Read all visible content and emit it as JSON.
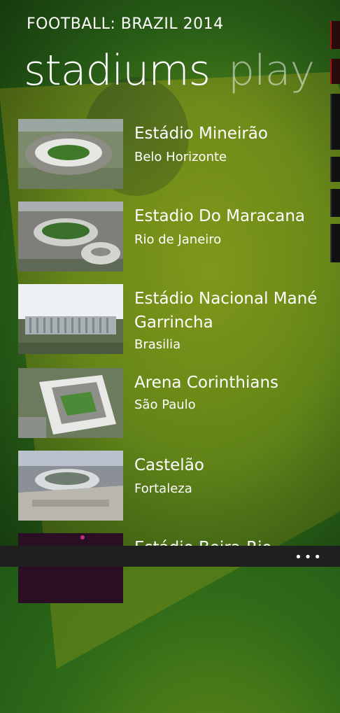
{
  "app_title": "FOOTBALL: BRAZIL 2014",
  "pivot": {
    "active": "stadiums",
    "next": "play"
  },
  "stadiums": [
    {
      "name": "Estádio Mineirão",
      "city": "Belo Horizonte"
    },
    {
      "name": "Estadio Do Maracana",
      "city": "Rio de Janeiro"
    },
    {
      "name": "Estádio Nacional Mané Garrincha",
      "city": "Brasilia"
    },
    {
      "name": "Arena Corinthians",
      "city": "São Paulo"
    },
    {
      "name": "Castelão",
      "city": "Fortaleza"
    },
    {
      "name": "Estádio Beira-Rio",
      "city": ""
    }
  ],
  "app_bar": {
    "more": "•••"
  }
}
